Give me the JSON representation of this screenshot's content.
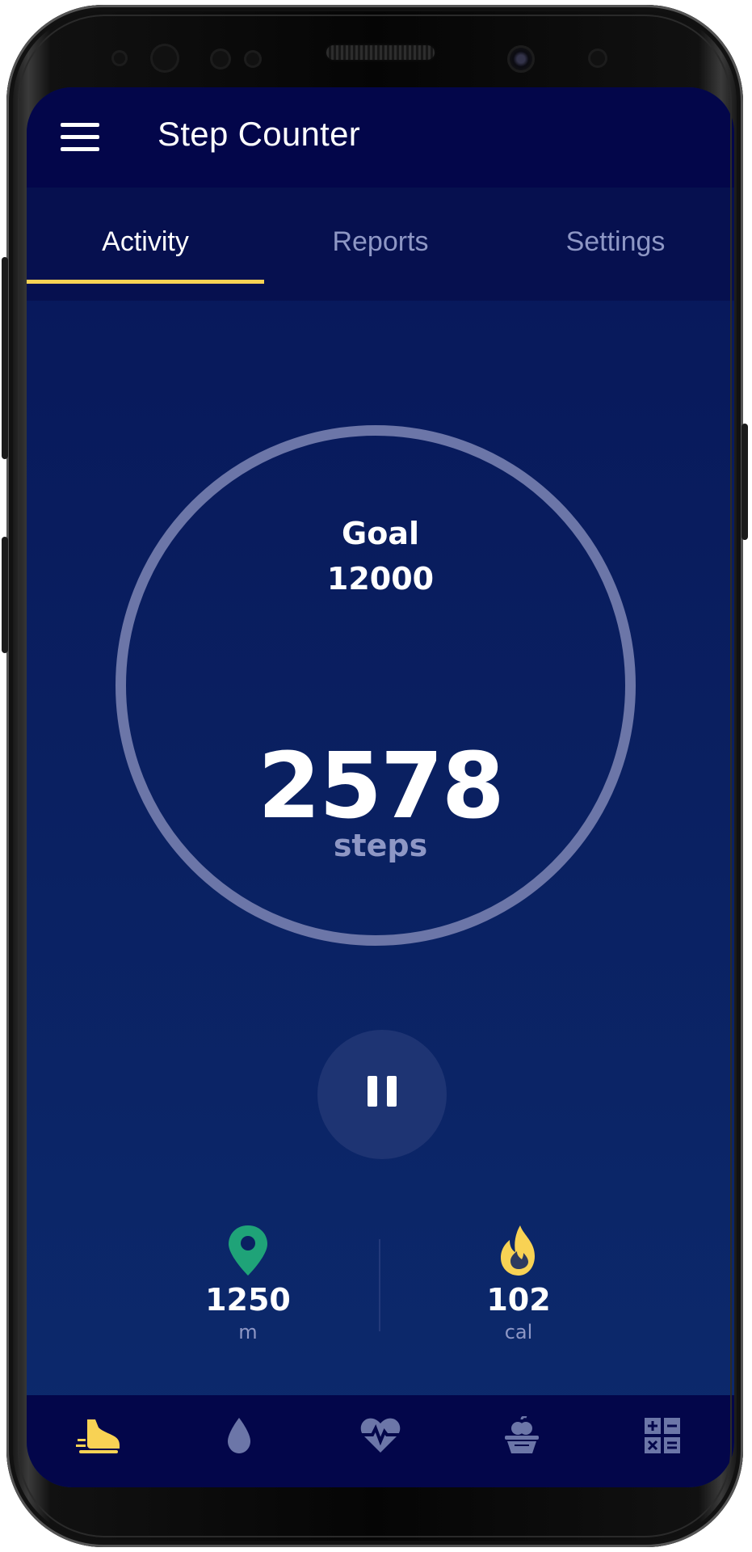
{
  "app": {
    "title": "Step Counter"
  },
  "tabs": [
    {
      "label": "Activity",
      "active": true
    },
    {
      "label": "Reports",
      "active": false
    },
    {
      "label": "Settings",
      "active": false
    }
  ],
  "goal": {
    "label": "Goal",
    "value": "12000"
  },
  "counter": {
    "value": "2578",
    "unit": "steps"
  },
  "controls": {
    "pause_icon": "pause-icon"
  },
  "stats": {
    "distance": {
      "value": "1250",
      "unit": "m",
      "icon": "map-pin-icon"
    },
    "calories": {
      "value": "102",
      "unit": "cal",
      "icon": "flame-icon"
    }
  },
  "bottom_nav": [
    {
      "icon": "shoe-icon",
      "active": true
    },
    {
      "icon": "water-drop-icon",
      "active": false
    },
    {
      "icon": "heart-rate-icon",
      "active": false
    },
    {
      "icon": "food-scale-icon",
      "active": false
    },
    {
      "icon": "calculator-icon",
      "active": false
    }
  ],
  "colors": {
    "accent": "#f8d254",
    "appbar": "#03064a",
    "background": "#0a2061",
    "ring": "#6c76a8",
    "muted_text": "#8e97c5",
    "pin": "#1fa378",
    "flame": "#f8d254"
  }
}
